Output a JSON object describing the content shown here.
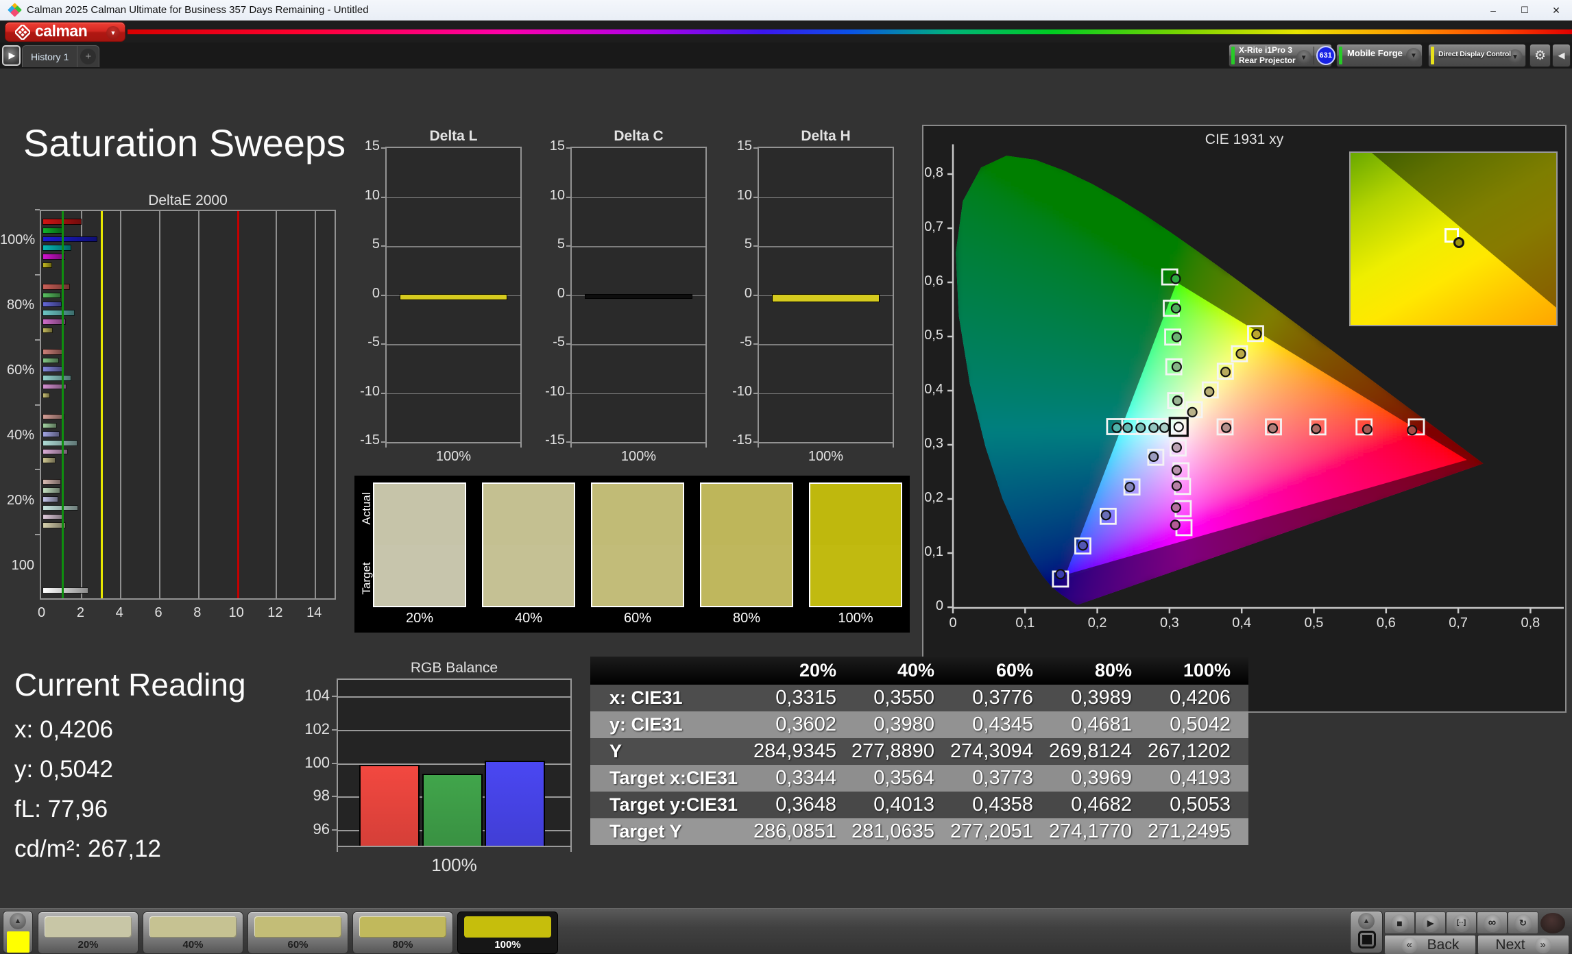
{
  "window": {
    "title": "Calman 2025 Calman Ultimate for Business 357 Days Remaining  - Untitled",
    "minimize": "–",
    "maximize": "☐",
    "close": "✕"
  },
  "brand": {
    "wordmark": "calman",
    "dropdown": "▼"
  },
  "tabs": {
    "history": "History 1",
    "add": "+",
    "play": "▶"
  },
  "device_bar": {
    "meter": {
      "line1": "X-Rite i1Pro 3",
      "line2": "Rear Projector",
      "badge": "631",
      "accent": "#27cb27",
      "arrow": "▼"
    },
    "source": {
      "label": "Mobile Forge",
      "accent": "#27cb27",
      "arrow": "▼"
    },
    "display_control": {
      "label": "Direct Display Control",
      "accent": "#e8e11a",
      "arrow": "▼"
    },
    "settings": "⚙",
    "collapse": "◀"
  },
  "page": {
    "title": "Saturation Sweeps"
  },
  "current_reading": {
    "title": "Current Reading",
    "lines": [
      "x: 0,4206",
      "y: 0,5042",
      "fL: 77,96",
      "cd/m²: 267,12"
    ]
  },
  "chart_data": [
    {
      "id": "deltae2000",
      "type": "bar",
      "orientation": "horizontal",
      "title": "DeltaE 2000",
      "categories": [
        "100%",
        "80%",
        "60%",
        "40%",
        "20%",
        "100"
      ],
      "series_names": [
        "red",
        "green",
        "blue",
        "cyan",
        "magenta",
        "yellow"
      ],
      "series_by_group": {
        "100%": [
          2.0,
          1.0,
          2.8,
          1.45,
          1.15,
          0.46
        ],
        "80%": [
          1.4,
          0.92,
          0.95,
          1.64,
          1.17,
          0.49
        ],
        "60%": [
          1.05,
          0.82,
          1.0,
          1.45,
          1.2,
          0.35
        ],
        "40%": [
          1.1,
          0.73,
          0.85,
          1.78,
          1.27,
          0.65
        ],
        "20%": [
          0.93,
          0.89,
          0.79,
          1.8,
          1.09,
          1.19
        ],
        "100": [
          2.34
        ]
      },
      "bar_colors_by_group": {
        "100%": [
          "#d01414",
          "#10b42a",
          "#1b1bd0",
          "#06b6b6",
          "#cf13cf",
          "#c5ba20"
        ],
        "80%": [
          "#c95f57",
          "#59c161",
          "#6468d8",
          "#6cc6c4",
          "#cf6cc9",
          "#c3b95e"
        ],
        "60%": [
          "#cd7f78",
          "#82c684",
          "#8487dd",
          "#92d0cc",
          "#d28fd0",
          "#c9c075"
        ],
        "40%": [
          "#d39d95",
          "#a3d2a2",
          "#a2a4e2",
          "#aedbd6",
          "#d9abd5",
          "#cfc792"
        ],
        "20%": [
          "#d8bab2",
          "#c2dfc0",
          "#c3c4e9",
          "#c8e5e0",
          "#dfcadb",
          "#d6d0ac"
        ],
        "100": [
          "#ffffff"
        ]
      },
      "xlim": [
        0,
        15.1
      ],
      "x_ticks": [
        0,
        2,
        4,
        6,
        8,
        10,
        12,
        14
      ],
      "reference_lines": [
        {
          "value": 1,
          "color": "#0e8f0e"
        },
        {
          "value": 3,
          "color": "#e8e800"
        },
        {
          "value": 10,
          "color": "#c40000"
        }
      ]
    },
    {
      "id": "deltaL",
      "type": "bar",
      "title": "Delta L",
      "categories": [
        "100%"
      ],
      "values": [
        -0.45
      ],
      "bar_color": "#d6cb1f",
      "ylim": [
        -15,
        15
      ],
      "y_ticks": [
        15,
        10,
        5,
        0,
        -5,
        -10,
        -15
      ]
    },
    {
      "id": "deltaC",
      "type": "bar",
      "title": "Delta C",
      "categories": [
        "100%"
      ],
      "values": [
        -0.3
      ],
      "bar_color": "#0d0d0d",
      "ylim": [
        -15,
        15
      ],
      "y_ticks": [
        15,
        10,
        5,
        0,
        -5,
        -10,
        -15
      ]
    },
    {
      "id": "deltaH",
      "type": "bar",
      "title": "Delta H",
      "categories": [
        "100%"
      ],
      "values": [
        -0.6
      ],
      "bar_color": "#d6cb1f",
      "ylim": [
        -15,
        15
      ],
      "y_ticks": [
        15,
        10,
        5,
        0,
        -5,
        -10,
        -15
      ]
    },
    {
      "id": "swatch_compare",
      "type": "table",
      "row_labels": [
        "Actual",
        "Target"
      ],
      "categories": [
        "20%",
        "40%",
        "60%",
        "80%",
        "100%"
      ],
      "actual_colors": [
        "#c6c4a9",
        "#c4c091",
        "#c1bb76",
        "#beb65a",
        "#bfb80d"
      ],
      "target_colors": [
        "#c7c5ac",
        "#c5c194",
        "#c2bc79",
        "#bfb75d",
        "#c1ba10"
      ]
    },
    {
      "id": "cie1931",
      "type": "scatter",
      "title": "CIE 1931 xy",
      "xlim": [
        0,
        0.851
      ],
      "ylim": [
        0,
        0.855
      ],
      "x_ticks": [
        "0",
        "0,1",
        "0,2",
        "0,3",
        "0,4",
        "0,5",
        "0,6",
        "0,7",
        "0,8"
      ],
      "y_ticks": [
        "0",
        "0,1",
        "0,2",
        "0,3",
        "0,4",
        "0,5",
        "0,6",
        "0,7",
        "0,8"
      ],
      "gamut_triangle": [
        [
          0.712,
          0.272
        ],
        [
          0.31,
          0.6
        ],
        [
          0.156,
          0.06
        ]
      ],
      "white_point": {
        "target": [
          0.3127,
          0.333
        ],
        "measured": [
          0.3127,
          0.333
        ],
        "fill": "#f5f5f5"
      },
      "sweeps": {
        "red": {
          "targets": [
            [
              0.377,
              0.333
            ],
            [
              0.444,
              0.333
            ],
            [
              0.5055,
              0.333
            ],
            [
              0.5695,
              0.333
            ],
            [
              0.642,
              0.333
            ]
          ],
          "measured": [
            [
              0.3785,
              0.3315
            ],
            [
              0.443,
              0.3305
            ],
            [
              0.503,
              0.3295
            ],
            [
              0.574,
              0.3285
            ],
            [
              0.636,
              0.327
            ]
          ],
          "fills": [
            "#b5908b",
            "#b17f7a",
            "#ac6a64",
            "#a85a55",
            "#a84a45"
          ]
        },
        "green": {
          "targets": [
            [
              0.3085,
              0.3815
            ],
            [
              0.306,
              0.444
            ],
            [
              0.3045,
              0.499
            ],
            [
              0.3025,
              0.552
            ],
            [
              0.3003,
              0.61
            ]
          ],
          "measured": [
            [
              0.311,
              0.3815
            ],
            [
              0.31,
              0.444
            ],
            [
              0.31,
              0.499
            ],
            [
              0.309,
              0.552
            ],
            [
              0.3085,
              0.6065
            ]
          ],
          "fills": [
            "#9ab694",
            "#85b585",
            "#6cb271",
            "#50ad5c",
            "#2fae41"
          ]
        },
        "blue": {
          "targets": [
            [
              0.281,
              0.277
            ],
            [
              0.248,
              0.222
            ],
            [
              0.215,
              0.168
            ],
            [
              0.18,
              0.113
            ],
            [
              0.149,
              0.052
            ]
          ],
          "measured": [
            [
              0.278,
              0.278
            ],
            [
              0.245,
              0.222
            ],
            [
              0.212,
              0.17
            ],
            [
              0.18,
              0.114
            ],
            [
              0.149,
              0.061
            ]
          ],
          "fills": [
            "#9a9cc0",
            "#8486bd",
            "#6a6eb8",
            "#5356b3",
            "#3c3fae"
          ]
        },
        "cyan": {
          "targets": [
            [
              0.306,
              0.3335
            ],
            [
              0.287,
              0.3335
            ],
            [
              0.266,
              0.3335
            ],
            [
              0.245,
              0.3335
            ],
            [
              0.224,
              0.3335
            ]
          ],
          "measured": [
            [
              0.293,
              0.3315
            ],
            [
              0.278,
              0.3315
            ],
            [
              0.26,
              0.3315
            ],
            [
              0.242,
              0.3315
            ],
            [
              0.227,
              0.3315
            ]
          ],
          "fills": [
            "#a9cdc6",
            "#93c6bf",
            "#7cc0b8",
            "#65bab2",
            "#4fb4ab"
          ]
        },
        "magenta": {
          "targets": [
            [
              0.312,
              0.294
            ],
            [
              0.316,
              0.252
            ],
            [
              0.318,
              0.223
            ],
            [
              0.319,
              0.182
            ],
            [
              0.32,
              0.147
            ]
          ],
          "measured": [
            [
              0.31,
              0.295
            ],
            [
              0.31,
              0.253
            ],
            [
              0.31,
              0.224
            ],
            [
              0.309,
              0.184
            ],
            [
              0.308,
              0.152
            ]
          ],
          "fills": [
            "#bba4b4",
            "#b992ae",
            "#b780a6",
            "#b56e9e",
            "#b35a95"
          ]
        },
        "yellow": {
          "targets": [
            [
              0.3344,
              0.3648
            ],
            [
              0.3564,
              0.4013
            ],
            [
              0.3773,
              0.4358
            ],
            [
              0.3969,
              0.4682
            ],
            [
              0.4193,
              0.5053
            ]
          ],
          "measured": [
            [
              0.3315,
              0.3602
            ],
            [
              0.355,
              0.398
            ],
            [
              0.3776,
              0.4345
            ],
            [
              0.3989,
              0.4681
            ],
            [
              0.4206,
              0.5042
            ]
          ],
          "fills": [
            "#b8b189",
            "#b8ae74",
            "#b9ab5e",
            "#baa947",
            "#bba62f"
          ]
        }
      }
    },
    {
      "id": "rgb_balance",
      "type": "bar",
      "title": "RGB Balance",
      "categories": [
        "100%"
      ],
      "series": [
        {
          "name": "Red",
          "values": [
            99.9
          ],
          "color": "#f24840"
        },
        {
          "name": "Green",
          "values": [
            99.35
          ],
          "color": "#41a54b"
        },
        {
          "name": "Blue",
          "values": [
            100.15
          ],
          "color": "#4a47f2"
        }
      ],
      "ylim": [
        95.05,
        105.0
      ],
      "y_ticks": [
        104,
        102,
        100,
        98,
        96
      ],
      "xlabel": "100%"
    },
    {
      "id": "measurement_table",
      "type": "table",
      "columns": [
        "",
        "20%",
        "40%",
        "60%",
        "80%",
        "100%"
      ],
      "rows": [
        {
          "label": "x: CIE31",
          "values": [
            "0,3315",
            "0,3550",
            "0,3776",
            "0,3989",
            "0,4206"
          ]
        },
        {
          "label": "y: CIE31",
          "values": [
            "0,3602",
            "0,3980",
            "0,4345",
            "0,4681",
            "0,5042"
          ]
        },
        {
          "label": "Y",
          "values": [
            "284,9345",
            "277,8890",
            "274,3094",
            "269,8124",
            "267,1202"
          ]
        },
        {
          "label": "Target x:CIE31",
          "values": [
            "0,3344",
            "0,3564",
            "0,3773",
            "0,3969",
            "0,4193"
          ]
        },
        {
          "label": "Target y:CIE31",
          "values": [
            "0,3648",
            "0,4013",
            "0,4358",
            "0,4682",
            "0,5053"
          ]
        },
        {
          "label": "Target Y",
          "values": [
            "286,0851",
            "281,0635",
            "277,2051",
            "274,1770",
            "271,2495"
          ]
        }
      ],
      "row_colors": [
        "#4d4d4d",
        "#929292",
        "#4d4d4d",
        "#8e8e8e",
        "#484848",
        "#979797"
      ],
      "header_bg": "#0a0a0a"
    }
  ],
  "toolbar": {
    "pattern_popup": {
      "chevron": "▲",
      "color": "#ffff00"
    },
    "patches": [
      {
        "label": "20%",
        "color": "#c8c6a6",
        "selected": false
      },
      {
        "label": "40%",
        "color": "#c6c292",
        "selected": false
      },
      {
        "label": "60%",
        "color": "#c3bd77",
        "selected": false
      },
      {
        "label": "80%",
        "color": "#c1b95c",
        "selected": false
      },
      {
        "label": "100%",
        "color": "#c6be0c",
        "selected": true
      }
    ],
    "window_popup": {
      "chevron": "▲"
    },
    "transport": [
      {
        "name": "stop",
        "glyph": "■"
      },
      {
        "name": "play",
        "glyph": "▶"
      },
      {
        "name": "pattern-range",
        "glyph": "[··]"
      },
      {
        "name": "continuous",
        "glyph": "∞"
      },
      {
        "name": "refresh",
        "glyph": "↻"
      }
    ],
    "back": {
      "label": "Back",
      "icon": "«"
    },
    "next": {
      "label": "Next",
      "icon": "»"
    }
  }
}
